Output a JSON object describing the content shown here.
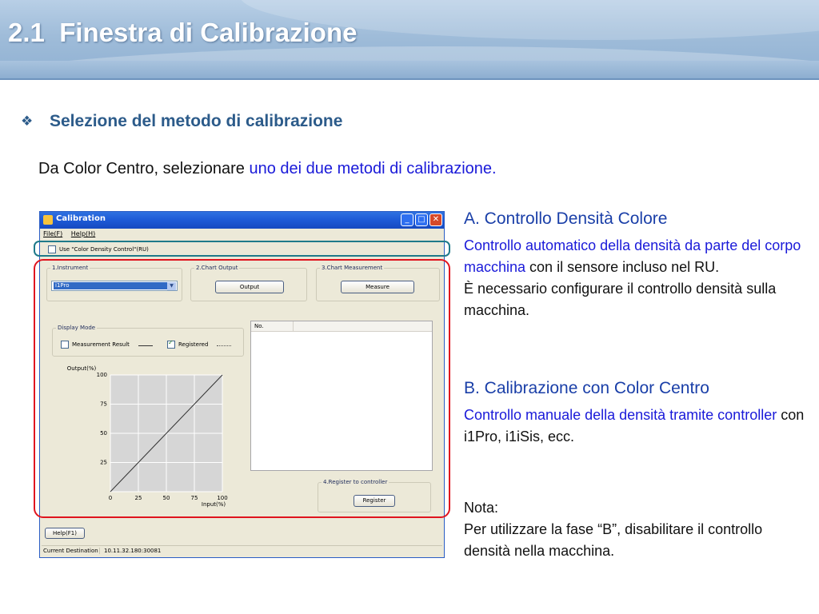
{
  "header": {
    "title": "2.1  Finestra di Calibrazione"
  },
  "section": {
    "bullet_icon": "diamond-bullet-icon",
    "heading": "Selezione del metodo di calibrazione",
    "intro_plain": "Da Color Centro, selezionare ",
    "intro_highlight": "uno dei due metodi di calibrazione."
  },
  "right_panel": {
    "a_title": "A. Controllo Densità Colore",
    "a_blue": "Controllo automatico della densità da parte del corpo macchina",
    "a_plain": " con il sensore incluso nel RU.",
    "a_line2": "È necessario configurare il controllo densità sulla macchina.",
    "b_title": "B. Calibrazione con Color Centro",
    "b_blue": "Controllo manuale della densità tramite controller",
    "b_plain": " con i1Pro, i1iSis, ecc.",
    "note_title": "Nota:",
    "note_body": "Per utilizzare la fase “B”, disabilitare il controllo densità nella macchina."
  },
  "window": {
    "title": "Calibration",
    "menu": [
      "File(F)",
      "Help(H)"
    ],
    "use_density_label": "Use \"Color Density Control\"(RU)",
    "use_density_checked": false,
    "instrument": {
      "label": "1.Instrument",
      "selected": "i1Pro"
    },
    "chart_output": {
      "label": "2.Chart Output",
      "button": "Output"
    },
    "chart_measurement": {
      "label": "3.Chart Measurement",
      "button": "Measure"
    },
    "display_mode": {
      "label": "Display Mode",
      "measurement_result": "Measurement Result",
      "measurement_result_checked": false,
      "registered": "Registered",
      "registered_checked": true
    },
    "list_header": "No.",
    "register": {
      "label": "4.Register to controller",
      "button": "Register"
    },
    "help_button": "Help(F1)",
    "status": {
      "label": "Current Destination",
      "value": "10.11.32.180:30081"
    },
    "window_buttons": [
      "minimize-icon",
      "maximize-icon",
      "close-icon"
    ]
  },
  "chart_data": {
    "type": "line",
    "ylabel": "Output(%)",
    "xlabel": "Input(%)",
    "x_ticks": [
      "0",
      "25",
      "50",
      "75",
      "100"
    ],
    "y_ticks": [
      "0",
      "25",
      "50",
      "75",
      "100"
    ],
    "xlim": [
      0,
      100
    ],
    "ylim": [
      0,
      100
    ],
    "grid": true,
    "series": [
      {
        "x": [
          0,
          25,
          50,
          75,
          100
        ],
        "y": [
          0,
          25,
          50,
          75,
          100
        ]
      }
    ]
  }
}
